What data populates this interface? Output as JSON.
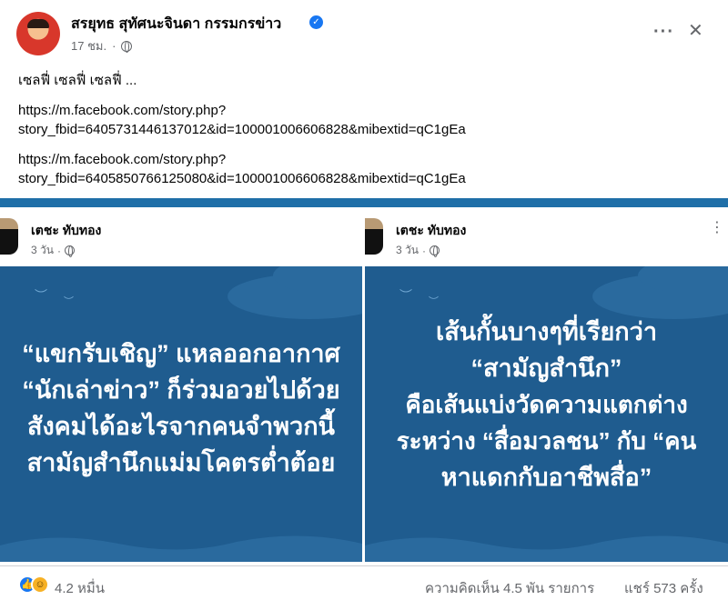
{
  "post": {
    "author": "สรยุทธ สุทัศนะจินดา กรรมกรข่าว",
    "time": "17 ชม.",
    "text_line1": "เซลฟี่ เซลฟี่ เซลฟี่ ...",
    "link1_line1": "https://m.facebook.com/story.php?",
    "link1_line2": "story_fbid=6405731446137012&id=100001006606828&mibextid=qC1gEa",
    "link2_line1": "https://m.facebook.com/story.php?",
    "link2_line2": "story_fbid=6405850766125080&id=100001006606828&mibextid=qC1gEa"
  },
  "cards": [
    {
      "name": "เตชะ ทับทอง",
      "time": "3 วัน",
      "lines": [
        "“แขกรับเชิญ” แหลออกอากาศ",
        "“นักเล่าข่าว” ก็ร่วมอวยไปด้วย",
        "สังคมได้อะไรจากคนจำพวกนี้",
        "สามัญสำนึกแม่มโคตรต่ำต้อย"
      ]
    },
    {
      "name": "เตชะ ทับทอง",
      "time": "3 วัน",
      "lines": [
        "เส้นกั้นบางๆที่เรียกว่า",
        "“สามัญสำนึก”",
        "คือเส้นแบ่งวัดความแตกต่าง",
        "ระหว่าง “สื่อมวลชน” กับ “คน",
        "หาแดกกับอาชีพสื่อ”"
      ]
    }
  ],
  "footer": {
    "reactions": "4.2 หมื่น",
    "comments": "ความคิดเห็น 4.5 พัน รายการ",
    "shares": "แชร์ 573 ครั้ง"
  },
  "icons": {
    "verified": "verified-badge-icon",
    "globe": "globe-icon",
    "like": "like-reaction-icon",
    "haha": "haha-reaction-icon"
  },
  "colors": {
    "accent": "#1877f2",
    "card_bg": "#1f5c8f",
    "muted": "#65676b"
  }
}
